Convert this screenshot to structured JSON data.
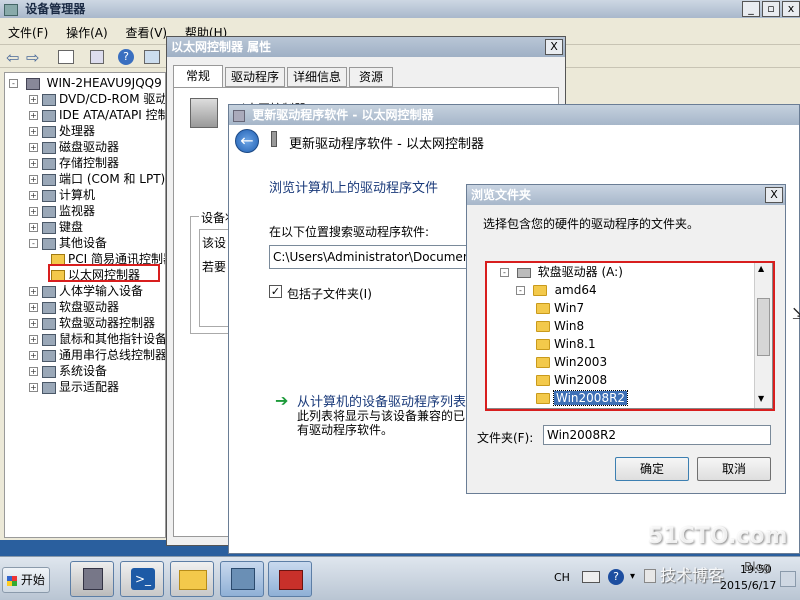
{
  "devmgr": {
    "title": "设备管理器",
    "menu": [
      "文件(F)",
      "操作(A)",
      "查看(V)",
      "帮助(H)"
    ],
    "tree_root": "WIN-2HEAVU9JQQ9",
    "tree": [
      {
        "label": "DVD/CD-ROM 驱动器",
        "exp": "+"
      },
      {
        "label": "IDE ATA/ATAPI 控制器",
        "exp": "+"
      },
      {
        "label": "处理器",
        "exp": "+"
      },
      {
        "label": "磁盘驱动器",
        "exp": "+"
      },
      {
        "label": "存储控制器",
        "exp": "+"
      },
      {
        "label": "端口 (COM 和 LPT)",
        "exp": "+"
      },
      {
        "label": "计算机",
        "exp": "+"
      },
      {
        "label": "监视器",
        "exp": "+"
      },
      {
        "label": "键盘",
        "exp": "+"
      },
      {
        "label": "其他设备",
        "exp": "-"
      },
      {
        "label": "PCI 简易通讯控制器",
        "exp": ""
      },
      {
        "label": "以太网控制器",
        "exp": ""
      },
      {
        "label": "人体学输入设备",
        "exp": "+"
      },
      {
        "label": "软盘驱动器",
        "exp": "+"
      },
      {
        "label": "软盘驱动器控制器",
        "exp": "+"
      },
      {
        "label": "鼠标和其他指针设备",
        "exp": "+"
      },
      {
        "label": "通用串行总线控制器",
        "exp": "+"
      },
      {
        "label": "系统设备",
        "exp": "+"
      },
      {
        "label": "显示适配器",
        "exp": "+"
      }
    ]
  },
  "props": {
    "title": "以太网控制器 属性",
    "tabs": [
      "常规",
      "驱动程序",
      "详细信息",
      "资源"
    ],
    "device_partial": "以太网控制器",
    "group_label": "设备状",
    "status_lines": [
      "该设",
      "若要"
    ]
  },
  "update": {
    "window_title": "更新驱动程序软件 - 以太网控制器",
    "header": "更新驱动程序软件 - 以太网控制器",
    "section_title": "浏览计算机上的驱动程序文件",
    "search_label": "在以下位置搜索驱动程序软件:",
    "path_value": "C:\\Users\\Administrator\\Documen",
    "include_subfolders": "包括子文件夹(I)",
    "link_title": "从计算机的设备驱动程序列表",
    "link_desc_1": "此列表将显示与该设备兼容的已",
    "link_desc_2": "有驱动程序软件。"
  },
  "browse": {
    "title": "浏览文件夹",
    "close": "X",
    "instruction": "选择包含您的硬件的驱动程序的文件夹。",
    "drive": "软盘驱动器 (A:)",
    "amd64": "amd64",
    "folders": [
      "Win7",
      "Win8",
      "Win8.1",
      "Win2003",
      "Win2008",
      "Win2008R2"
    ],
    "folder_label": "文件夹(F):",
    "folder_value": "Win2008R2",
    "ok": "确定",
    "cancel": "取消"
  },
  "taskbar": {
    "start": "开始",
    "lang": "CH",
    "time": "19:50",
    "date": "2015/6/17"
  },
  "watermark": {
    "site": "51CTO.com",
    "sub": "技术博客",
    "blog": "Blog"
  }
}
